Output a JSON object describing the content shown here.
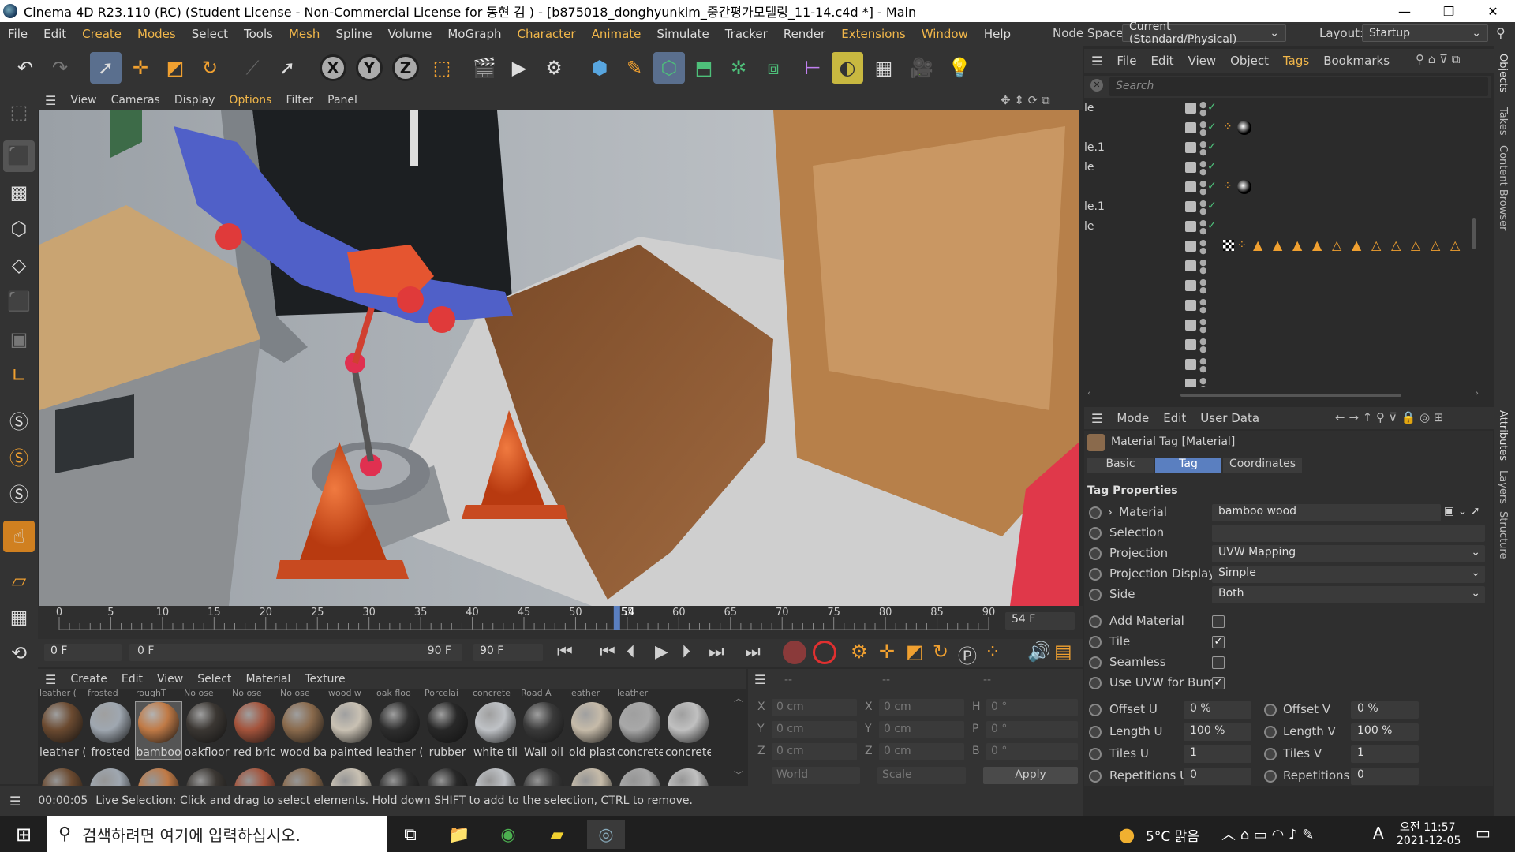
{
  "window": {
    "title": "Cinema 4D R23.110 (RC) (Student License - Non-Commercial License for 동현 김 ) - [b875018_donghyunkim_중간평가모델링_11-14.c4d *] - Main"
  },
  "menubar": {
    "items": [
      "File",
      "Edit",
      "Create",
      "Modes",
      "Select",
      "Tools",
      "Mesh",
      "Spline",
      "Volume",
      "MoGraph",
      "Character",
      "Animate",
      "Simulate",
      "Tracker",
      "Render",
      "Extensions",
      "Window",
      "Help"
    ],
    "node_space_label": "Node Space:",
    "node_space_value": "Current (Standard/Physical)",
    "layout_label": "Layout:",
    "layout_value": "Startup"
  },
  "viewport": {
    "menu": [
      "View",
      "Cameras",
      "Display",
      "Options",
      "Filter",
      "Panel"
    ]
  },
  "timeline": {
    "ticks": [
      "0",
      "5",
      "10",
      "15",
      "20",
      "25",
      "30",
      "35",
      "40",
      "45",
      "50",
      "55",
      "60",
      "65",
      "70",
      "75",
      "80",
      "85",
      "90"
    ],
    "current_label": "54",
    "current_frame": 54,
    "max_frame": 90,
    "frame_field": "54 F",
    "start_field": "0 F",
    "range_start": "0 F",
    "range_end": "90 F",
    "end_field": "90 F"
  },
  "material_manager": {
    "menu": [
      "Create",
      "Edit",
      "View",
      "Select",
      "Material",
      "Texture"
    ],
    "top_labels": [
      "leather (",
      "frosted",
      "roughT",
      "No ose",
      "No ose",
      "No ose",
      "wood w",
      "oak floo",
      "Porcelai",
      "concrete",
      "Road A",
      "leather",
      "leather"
    ],
    "materials": [
      {
        "name": "leather (",
        "color": "#6b4a30"
      },
      {
        "name": "frosted",
        "color": "#9fa7b0"
      },
      {
        "name": "bamboo",
        "color": "#c07a46"
      },
      {
        "name": "oakfloor",
        "color": "#3b3733"
      },
      {
        "name": "red bric",
        "color": "#a4533b"
      },
      {
        "name": "wood ba",
        "color": "#8a6a4c"
      },
      {
        "name": "painted",
        "color": "#c9c1b3"
      },
      {
        "name": "leather (",
        "color": "#2e2e2e"
      },
      {
        "name": "rubber",
        "color": "#282828"
      },
      {
        "name": "white til",
        "color": "#bfc2c6"
      },
      {
        "name": "Wall oil",
        "color": "#3a3a3a"
      },
      {
        "name": "old plast",
        "color": "#c6bba9"
      },
      {
        "name": "concrete",
        "color": "#a8a8a8"
      },
      {
        "name": "concrete",
        "color": "#c0c0c0"
      }
    ]
  },
  "coords": {
    "x": "0 cm",
    "y": "0 cm",
    "z": "0 cm",
    "sx": "0 cm",
    "sy": "0 cm",
    "sz": "0 cm",
    "h": "0 °",
    "p": "0 °",
    "b": "0 °",
    "world": "World",
    "scale": "Scale",
    "apply": "Apply",
    "headers": [
      "--",
      "--",
      "--"
    ]
  },
  "status": {
    "time": "00:00:05",
    "message": "Live Selection: Click and drag to select elements. Hold down SHIFT to add to the selection, CTRL to remove."
  },
  "object_manager": {
    "menu": [
      "File",
      "Edit",
      "View",
      "Object",
      "Tags",
      "Bookmarks"
    ],
    "search_placeholder": "Search",
    "rows": [
      "le",
      "",
      "le.1",
      "le",
      "",
      "le.1",
      "le",
      "",
      "",
      "",
      "",
      "",
      "",
      "",
      ""
    ]
  },
  "attributes": {
    "menu": [
      "Mode",
      "Edit",
      "User Data"
    ],
    "header": "Material Tag [Material]",
    "tabs": [
      "Basic",
      "Tag",
      "Coordinates"
    ],
    "section": "Tag Properties",
    "material_label": "Material",
    "material_value": "bamboo wood",
    "selection_label": "Selection",
    "projection_label": "Projection",
    "projection_value": "UVW Mapping",
    "projection_display_label": "Projection Display",
    "projection_display_value": "Simple",
    "side_label": "Side",
    "side_value": "Both",
    "add_material_label": "Add Material",
    "tile_label": "Tile",
    "seamless_label": "Seamless",
    "uvw_bump_label": "Use UVW for Bump",
    "offset_u_label": "Offset U",
    "offset_u": "0 %",
    "offset_v_label": "Offset V",
    "offset_v": "0 %",
    "length_u_label": "Length U",
    "length_u": "100 %",
    "length_v_label": "Length V",
    "length_v": "100 %",
    "tiles_u_label": "Tiles U",
    "tiles_u": "1",
    "tiles_v_label": "Tiles V",
    "tiles_v": "1",
    "rep_u_label": "Repetitions U",
    "rep_u": "0",
    "rep_v_label": "Repetitions V",
    "rep_v": "0"
  },
  "vertical_tabs": [
    "Objects",
    "Takes",
    "Content Browser",
    "Attributes",
    "Layers",
    "Structure"
  ],
  "taskbar": {
    "search_placeholder": "검색하려면 여기에 입력하십시오.",
    "weather": "5°C 맑음",
    "time": "오전 11:57",
    "date": "2021-12-05",
    "lang": "A"
  }
}
